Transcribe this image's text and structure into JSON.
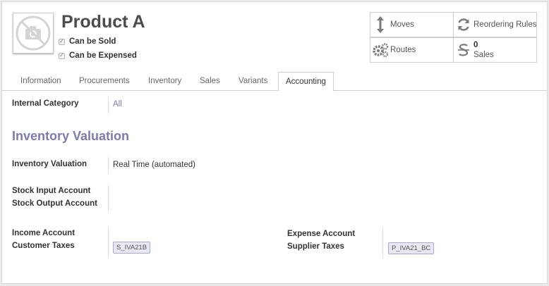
{
  "product": {
    "name": "Product A",
    "can_be_sold_label": "Can be Sold",
    "can_be_expensed_label": "Can be Expensed"
  },
  "smart_buttons": {
    "moves": "Moves",
    "reordering_rules": "Reordering Rules",
    "routes": "Routes",
    "sales_count": "0",
    "sales_label": "Sales"
  },
  "tabs": [
    "Information",
    "Procurements",
    "Inventory",
    "Sales",
    "Variants",
    "Accounting"
  ],
  "active_tab": "Accounting",
  "accounting": {
    "internal_category_label": "Internal Category",
    "internal_category_value": "All",
    "section_title": "Inventory Valuation",
    "inventory_valuation_label": "Inventory Valuation",
    "inventory_valuation_value": "Real Time (automated)",
    "stock_input_label": "Stock Input Account",
    "stock_output_label": "Stock Output Account",
    "income_account_label": "Income Account",
    "customer_taxes_label": "Customer Taxes",
    "customer_tax_tag": "S_IVA21B",
    "expense_account_label": "Expense Account",
    "supplier_taxes_label": "Supplier Taxes",
    "supplier_tax_tag": "P_IVA21_BC"
  },
  "icons": {
    "avatar": "camera-placeholder-icon",
    "moves": "arrows-vertical-icon",
    "reordering": "refresh-icon",
    "routes": "gears-icon",
    "sales": "currency-icon"
  },
  "colors": {
    "accent": "#7c7bad",
    "tag_bg": "#e8e8f3"
  }
}
